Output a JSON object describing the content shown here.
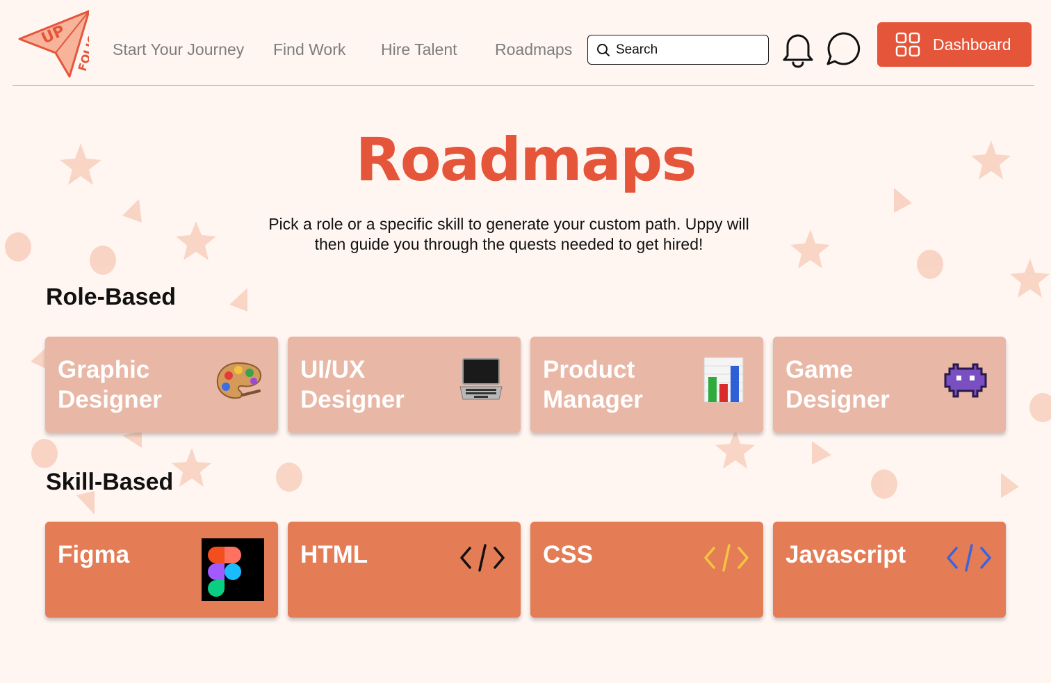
{
  "header": {
    "logo_text_top": "UP",
    "logo_text_bottom": "FOLIO",
    "nav": [
      {
        "label": "Start Your Journey"
      },
      {
        "label": "Find Work"
      },
      {
        "label": "Hire Talent"
      },
      {
        "label": "Roadmaps"
      }
    ],
    "search_placeholder": "Search",
    "dashboard_label": "Dashboard"
  },
  "main": {
    "title": "Roadmaps",
    "intro_line1": "Pick a role or a specific skill to generate your custom path. Uppy will",
    "intro_line2": "then guide you through the quests needed to get hired!",
    "role_heading": "Role-Based",
    "skill_heading": "Skill-Based",
    "roles": [
      {
        "label_line1": "Graphic",
        "label_line2": "Designer",
        "icon": "artist-palette-icon"
      },
      {
        "label_line1": "UI/UX",
        "label_line2": "Designer",
        "icon": "laptop-icon"
      },
      {
        "label_line1": "Product",
        "label_line2": "Manager",
        "icon": "bar-chart-icon"
      },
      {
        "label_line1": "Game",
        "label_line2": "Designer",
        "icon": "space-invader-icon"
      }
    ],
    "skills": [
      {
        "label": "Figma",
        "icon": "figma-logo-icon"
      },
      {
        "label": "HTML",
        "icon": "code-icon",
        "icon_color": "#111111"
      },
      {
        "label": "CSS",
        "icon": "code-icon",
        "icon_color": "#f5c542"
      },
      {
        "label": "Javascript",
        "icon": "code-icon",
        "icon_color": "#3b63e0"
      }
    ]
  },
  "colors": {
    "brand": "#e5553a",
    "background": "#fff6f2",
    "role_card": "#e8b7a5",
    "skill_card": "#e47c55"
  }
}
